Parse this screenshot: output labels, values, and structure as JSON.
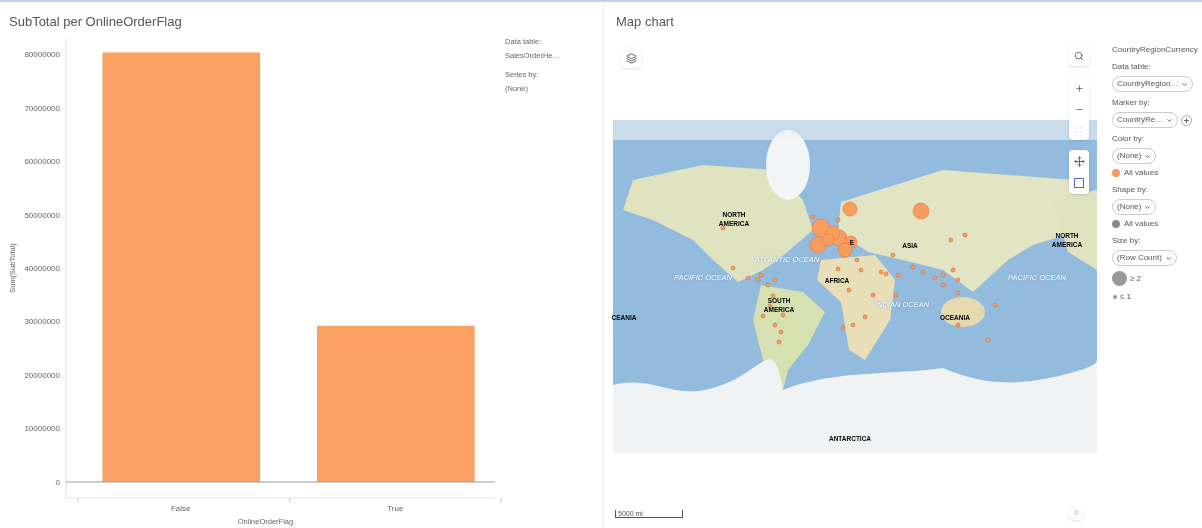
{
  "bar_panel": {
    "title": "SubTotal per OnlineOrderFlag",
    "chart_data": {
      "type": "bar",
      "xlabel": "OnlineOrderFlag",
      "ylabel": "Sum(SubTotal)",
      "categories": [
        "False",
        "True"
      ],
      "values": [
        80300000,
        29200000
      ],
      "ylim": [
        -3000000,
        83000000
      ],
      "yticks": [
        0,
        10000000,
        20000000,
        30000000,
        40000000,
        50000000,
        60000000,
        70000000,
        80000000
      ]
    },
    "legend": [
      {
        "kind": "label",
        "text": "Data table:"
      },
      {
        "kind": "value",
        "text": "SalesOrderHe…"
      },
      {
        "kind": "label",
        "text": "Series by:"
      },
      {
        "kind": "value",
        "text": "(None)"
      }
    ]
  },
  "map_panel": {
    "title": "Map chart",
    "map_labels": [
      "NORTH AMERICA",
      "ATLANTIC OCEAN",
      "PACIFIC OCEAN",
      "E",
      "ASIA",
      "AFRICA",
      "SOUTH AMERICA",
      "INDIAN OCEAN",
      "OCEANIA",
      "CEANIA",
      "NORTH AMERICA",
      "PACIFIC OCEAN",
      "ANTARCTICA"
    ],
    "scale": "5000 mi",
    "copyright": "©",
    "legend": [
      {
        "kind": "title",
        "text": "CountryRegionCurrency"
      },
      {
        "kind": "label",
        "text": "Data table:"
      },
      {
        "kind": "dropdown",
        "text": "CountryRegion…",
        "add_button": false
      },
      {
        "kind": "label",
        "text": "Marker by:"
      },
      {
        "kind": "dropdown",
        "text": "CountryRe…",
        "add_button": true
      },
      {
        "kind": "label",
        "text": "Color by:"
      },
      {
        "kind": "dropdown",
        "text": "(None)",
        "add_button": false
      },
      {
        "kind": "swatch",
        "text": "All values",
        "color": "#f79e5e"
      },
      {
        "kind": "label",
        "text": "Shape by:"
      },
      {
        "kind": "dropdown",
        "text": "(None)",
        "add_button": false
      },
      {
        "kind": "swatch",
        "text": "All values",
        "color": "#8c8c8c"
      },
      {
        "kind": "label",
        "text": "Size by:"
      },
      {
        "kind": "dropdown",
        "text": "(Row Count)",
        "add_button": false
      },
      {
        "kind": "large",
        "text": "≥ 2"
      },
      {
        "kind": "small",
        "text": "≤ 1"
      }
    ]
  }
}
